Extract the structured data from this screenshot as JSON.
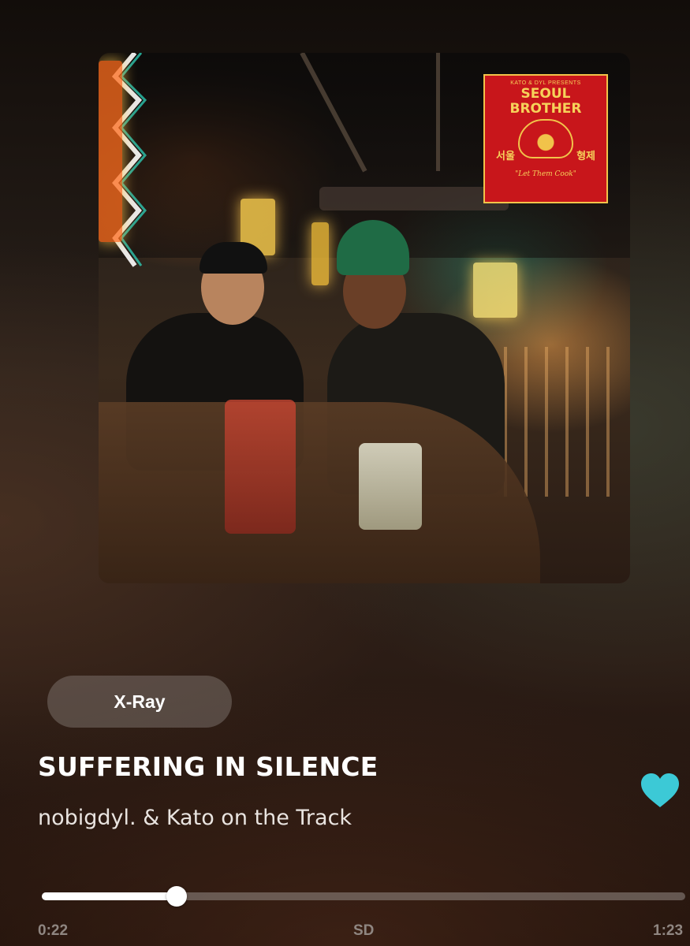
{
  "album_art": {
    "poster": {
      "presents": "KATO & DYL PRESENTS",
      "title_line1": "SEOUL",
      "title_line2": "BROTHER",
      "korean_left": "서울",
      "korean_right": "형제",
      "tagline": "\"Let Them Cook\""
    }
  },
  "xray": {
    "label": "X-Ray"
  },
  "track": {
    "title": "SUFFERING IN SILENCE",
    "artist": "nobigdyl. & Kato on the Track",
    "liked": true
  },
  "playback": {
    "elapsed": "0:22",
    "total": "1:23",
    "quality": "SD",
    "progress_fraction": 0.21
  },
  "colors": {
    "heart": "#3cc9d6",
    "progress_fill": "#ffffff",
    "progress_track": "#8c837e",
    "muted_text": "#8f8681"
  },
  "icons": {
    "like": "heart-icon"
  }
}
